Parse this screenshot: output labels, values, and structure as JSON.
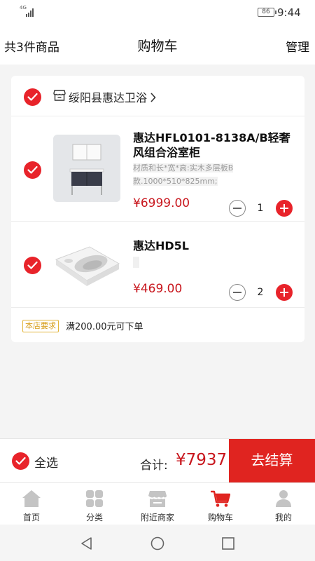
{
  "status_bar": {
    "network": "4G",
    "battery": "86",
    "time": "9:44"
  },
  "header": {
    "item_count": "共3件商品",
    "title": "购物车",
    "manage": "管理"
  },
  "shop": {
    "name": "绥阳县惠达卫浴"
  },
  "items": [
    {
      "title": "惠达HFL0101-8138A/B轻奢风组合浴室柜",
      "spec_line1": "材质和长*宽*高:实木多层板B",
      "spec_line2": "款.1000*510*825mm;",
      "price": "¥6999.00",
      "quantity": "1"
    },
    {
      "title": "惠达HD5L",
      "spec_line1": "",
      "spec_line2": "",
      "price": "¥469.00",
      "quantity": "2"
    }
  ],
  "store_requirement": {
    "badge": "本店要求",
    "text": "满200.00元可下单"
  },
  "checkout": {
    "select_all": "全选",
    "total_label": "合计:",
    "total_value": "¥7937",
    "button": "去结算"
  },
  "tabs": [
    {
      "label": "首页",
      "icon": "home-icon",
      "active": false
    },
    {
      "label": "分类",
      "icon": "category-icon",
      "active": false
    },
    {
      "label": "附近商家",
      "icon": "nearby-store-icon",
      "active": false
    },
    {
      "label": "购物车",
      "icon": "cart-icon",
      "active": true
    },
    {
      "label": "我的",
      "icon": "profile-icon",
      "active": false
    }
  ],
  "colors": {
    "accent": "#e8232a",
    "price": "#c8161d",
    "tab_active": "#e02420",
    "tab_inactive": "#c4c4c4",
    "badge": "#d69c16"
  }
}
